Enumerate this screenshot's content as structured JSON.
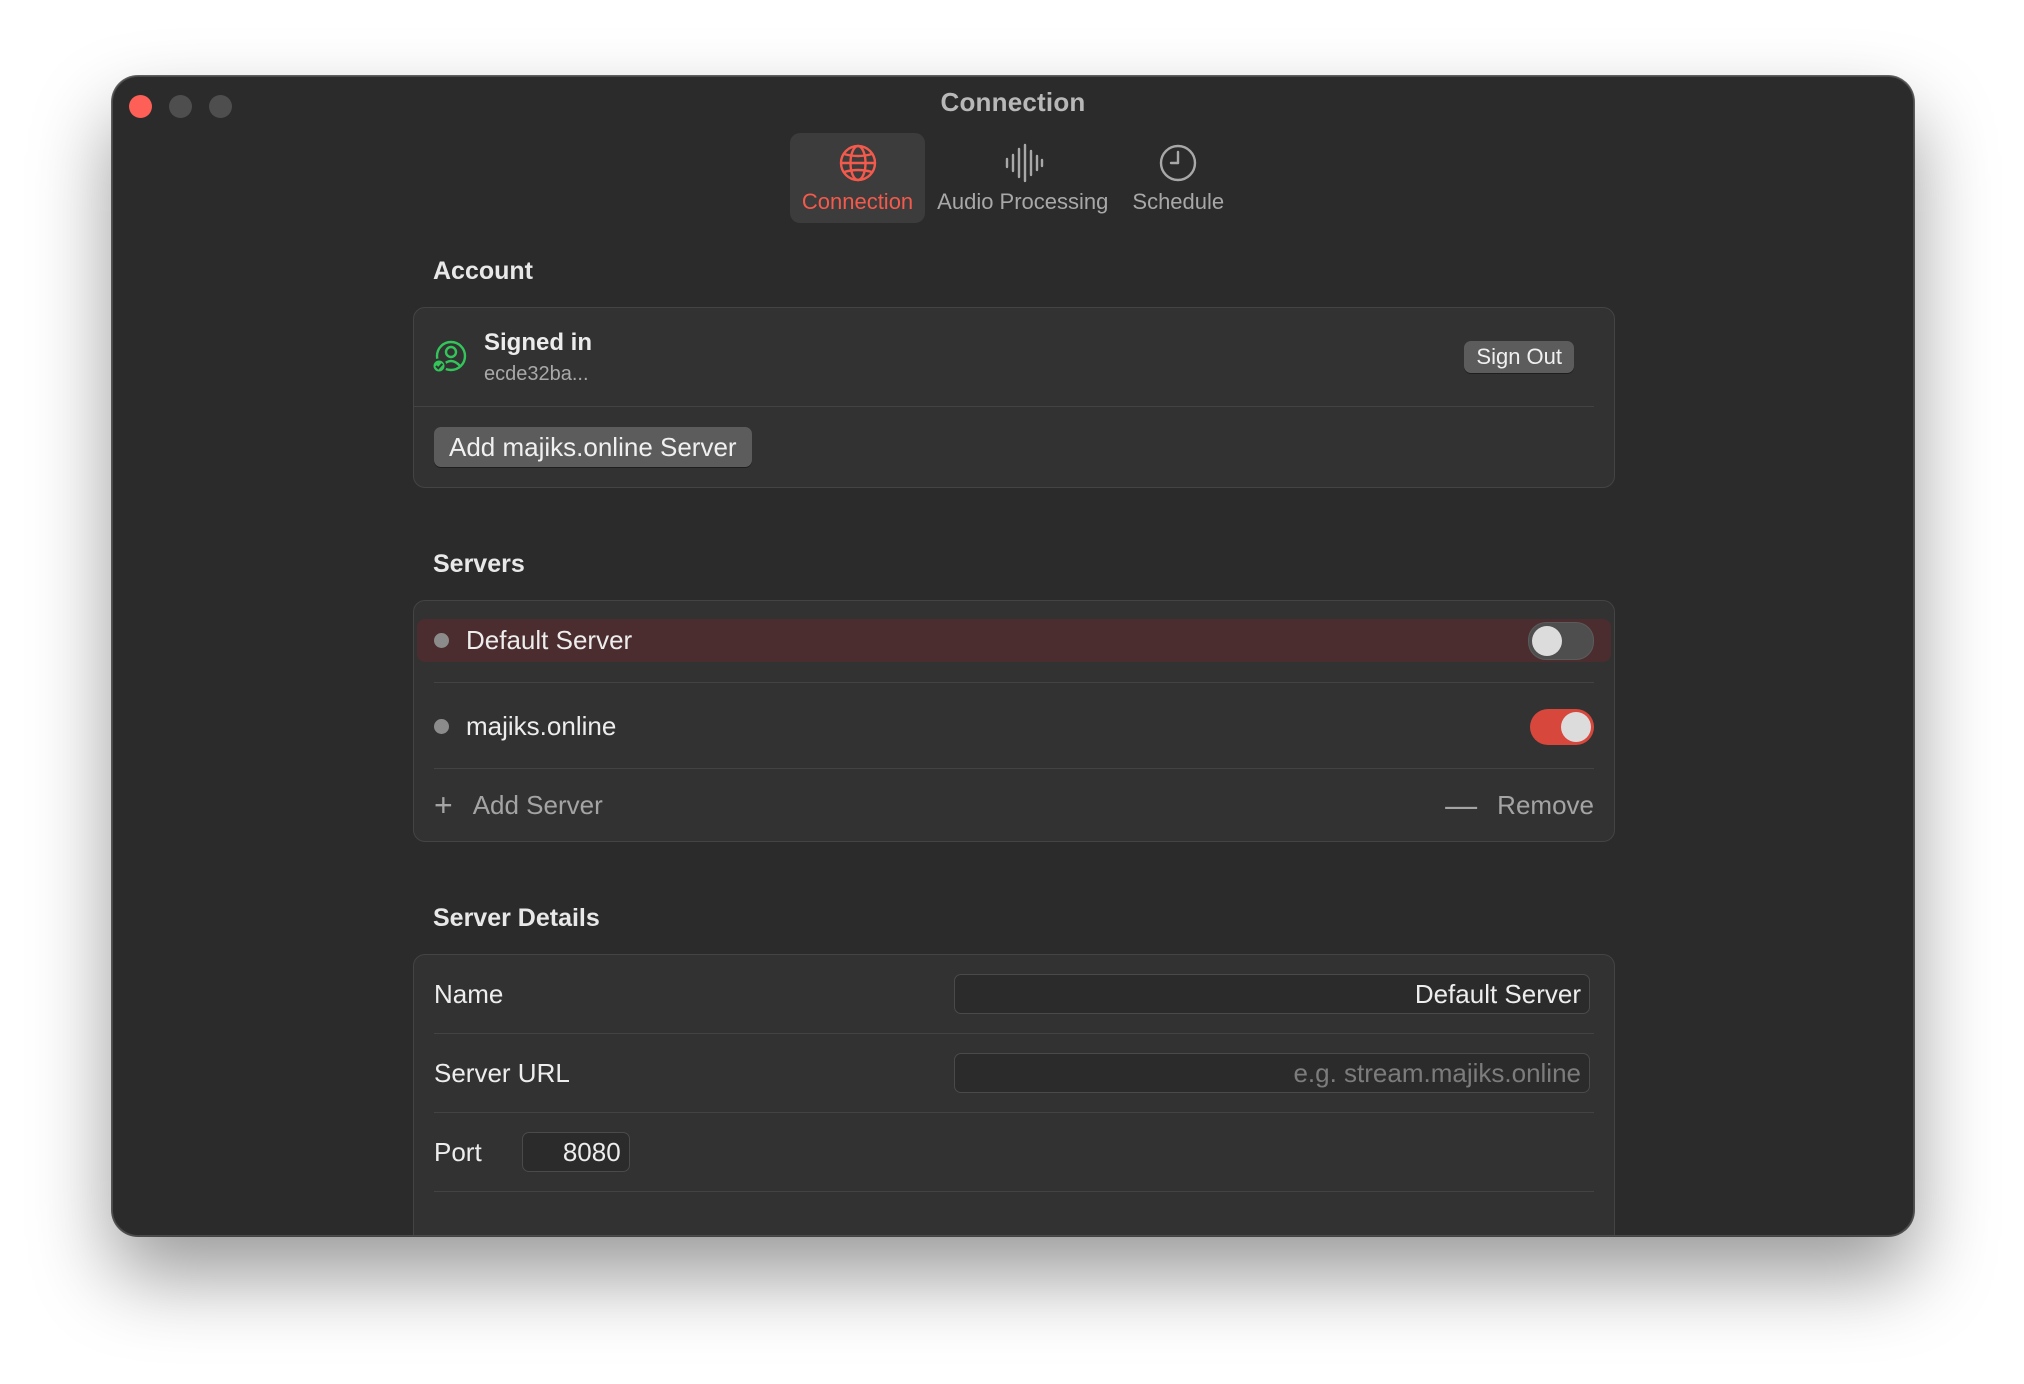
{
  "window": {
    "title": "Connection"
  },
  "toolbar": {
    "tabs": [
      {
        "label": "Connection",
        "icon": "globe-icon",
        "active": true
      },
      {
        "label": "Audio Processing",
        "icon": "waveform-icon",
        "active": false
      },
      {
        "label": "Schedule",
        "icon": "clock-icon",
        "active": false
      }
    ]
  },
  "account": {
    "section_title": "Account",
    "status": "Signed in",
    "user_id": "ecde32ba...",
    "sign_out_label": "Sign Out",
    "add_server_label": "Add majiks.online Server"
  },
  "servers": {
    "section_title": "Servers",
    "items": [
      {
        "name": "Default Server",
        "enabled": false,
        "selected": true
      },
      {
        "name": "majiks.online",
        "enabled": true,
        "selected": false
      }
    ],
    "add_label": "Add Server",
    "remove_label": "Remove"
  },
  "details": {
    "section_title": "Server Details",
    "name_label": "Name",
    "name_value": "Default Server",
    "url_label": "Server URL",
    "url_placeholder": "e.g. stream.majiks.online",
    "port_label": "Port",
    "port_value": "8080"
  },
  "colors": {
    "accent": "#f35a4c",
    "toggle_on": "#d8473c",
    "signed_in": "#33c55a",
    "selected_row": "#4b2d2f"
  }
}
